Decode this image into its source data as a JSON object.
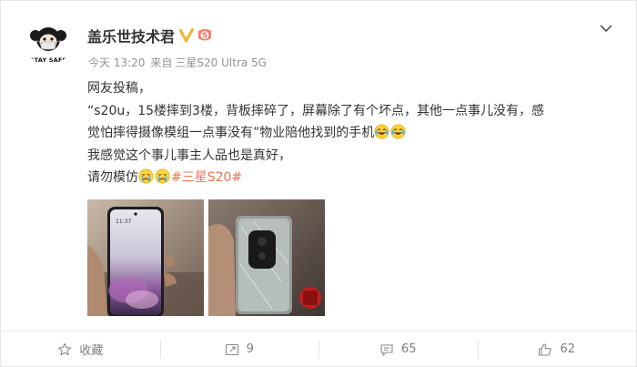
{
  "post": {
    "author": "盖乐世技术君",
    "avatar_text": "STAY SAFE",
    "time": "今天 13:20",
    "source_prefix": "来自",
    "source": "三星S20 Ultra 5G",
    "lines": {
      "l1": "网友投稿，",
      "l2": "“s20u，15楼摔到3楼，背板摔碎了，屏幕除了有个坏点，其他一点事儿没有，感",
      "l3": "觉怕摔得摄像模组一点事没有”物业陪他找到的手机",
      "l4": "我感觉这个事儿事主人品也是真好，",
      "l5_prefix": "请勿模仿",
      "hashtag": "#三星S20#"
    },
    "photo_screen_time": "11:37"
  },
  "footer": {
    "favorite_label": "收藏",
    "repost_count": "9",
    "comment_count": "65",
    "like_count": "62"
  },
  "icons": {
    "verified": "verified-v-icon",
    "level": "level-5-icon",
    "more": "chevron-down-icon",
    "favorite": "star-icon",
    "repost": "repost-icon",
    "comment": "comment-icon",
    "like": "thumbs-up-icon"
  },
  "colors": {
    "hashtag": "#eb7350",
    "meta": "#939393",
    "verified": "#f5b32d",
    "level": "#ff7a6a"
  }
}
